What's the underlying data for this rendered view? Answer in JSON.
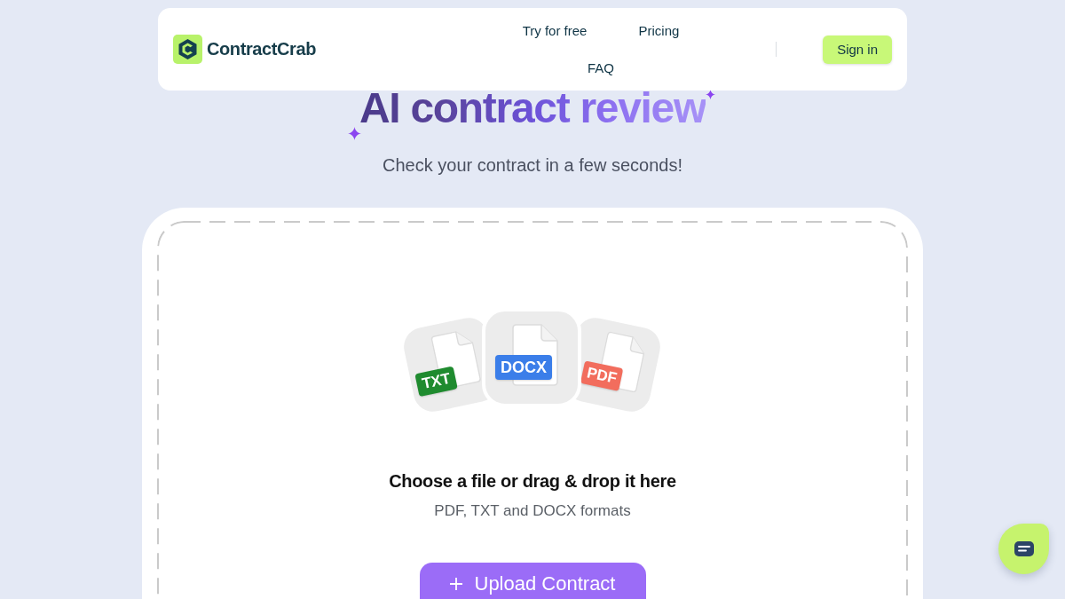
{
  "header": {
    "logo_text": "ContractCrab",
    "nav": [
      "Try for free",
      "Pricing",
      "FAQ"
    ],
    "sign_in": "Sign in"
  },
  "hero": {
    "title": "AI contract review",
    "subtitle": "Check your contract in a few seconds!"
  },
  "upload": {
    "file_types": [
      {
        "label": "TXT",
        "color": "#1f8b2f"
      },
      {
        "label": "DOCX",
        "color": "#3b7ee9"
      },
      {
        "label": "PDF",
        "color": "#f26d5d"
      }
    ],
    "prompt": "Choose a file or drag & drop it here",
    "formats": "PDF, TXT and DOCX formats",
    "button": "Upload Contract"
  }
}
